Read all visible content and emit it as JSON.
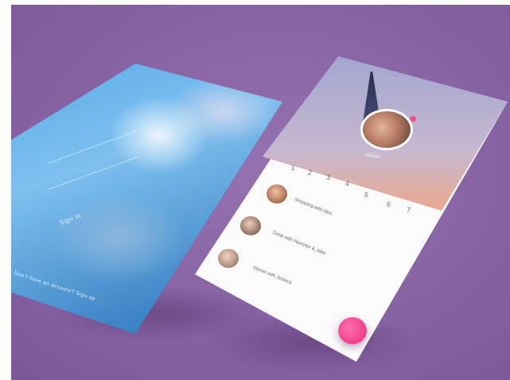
{
  "left_screen": {
    "sign_in_label": "Sign In",
    "signup_text": "Don't have an account? Sign up"
  },
  "right_screen": {
    "profile_name": "Allison",
    "days": [
      "1",
      "2",
      "3",
      "4",
      "5",
      "6",
      "7"
    ],
    "items": [
      {
        "text": "Shopping with Alex"
      },
      {
        "text": "Drink with Hammer & Jake"
      },
      {
        "text": "Dinner with Jessica"
      }
    ]
  },
  "colors": {
    "background": "#8a66a6",
    "accent": "#f03f8c",
    "header_blue": "#3a5493"
  },
  "icons": {
    "fab": "pink-action-button",
    "notification": "notification-dot"
  }
}
